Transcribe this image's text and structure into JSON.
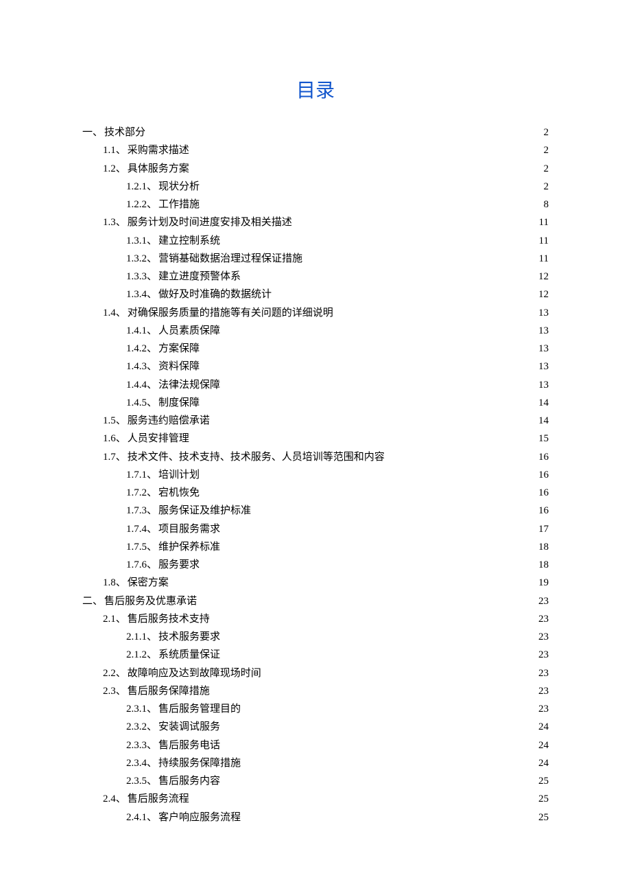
{
  "title": "目录",
  "toc": [
    {
      "level": 1,
      "num": "一、",
      "text": "技术部分",
      "page": "2"
    },
    {
      "level": 2,
      "num": "1.1、",
      "text": "采购需求描述",
      "page": "2"
    },
    {
      "level": 2,
      "num": "1.2、",
      "text": "具体服务方案",
      "page": "2"
    },
    {
      "level": 3,
      "num": "1.2.1、",
      "text": "现状分析",
      "page": "2"
    },
    {
      "level": 3,
      "num": "1.2.2、",
      "text": "工作措施",
      "page": "8"
    },
    {
      "level": 2,
      "num": "1.3、",
      "text": "服务计划及时间进度安排及相关描述",
      "page": "11"
    },
    {
      "level": 3,
      "num": "1.3.1、",
      "text": "建立控制系统",
      "page": "11"
    },
    {
      "level": 3,
      "num": "1.3.2、",
      "text": "营销基础数据治理过程保证措施",
      "page": "11"
    },
    {
      "level": 3,
      "num": "1.3.3、",
      "text": "建立进度预警体系",
      "page": "12"
    },
    {
      "level": 3,
      "num": "1.3.4、",
      "text": "做好及时准确的数据统计",
      "page": "12"
    },
    {
      "level": 2,
      "num": "1.4、",
      "text": "对确保服务质量的措施等有关问题的详细说明",
      "page": "13"
    },
    {
      "level": 3,
      "num": "1.4.1、",
      "text": "人员素质保障",
      "page": "13"
    },
    {
      "level": 3,
      "num": "1.4.2、",
      "text": "方案保障",
      "page": "13"
    },
    {
      "level": 3,
      "num": "1.4.3、",
      "text": "资料保障",
      "page": "13"
    },
    {
      "level": 3,
      "num": "1.4.4、",
      "text": "法律法规保障",
      "page": "13"
    },
    {
      "level": 3,
      "num": "1.4.5、",
      "text": "制度保障",
      "page": "14"
    },
    {
      "level": 2,
      "num": "1.5、",
      "text": "服务违约赔偿承诺",
      "page": "14"
    },
    {
      "level": 2,
      "num": "1.6、",
      "text": "人员安排管理",
      "page": "15"
    },
    {
      "level": 2,
      "num": "1.7、",
      "text": "技术文件、技术支持、技术服务、人员培训等范围和内容",
      "page": "16"
    },
    {
      "level": 3,
      "num": "1.7.1、",
      "text": "培训计划",
      "page": "16"
    },
    {
      "level": 3,
      "num": "1.7.2、",
      "text": "宕机恢免",
      "page": "16"
    },
    {
      "level": 3,
      "num": "1.7.3、",
      "text": "服务保证及维护标准",
      "page": "16"
    },
    {
      "level": 3,
      "num": "1.7.4、",
      "text": "项目服务需求",
      "page": "17"
    },
    {
      "level": 3,
      "num": "1.7.5、",
      "text": "维护保养标准",
      "page": "18"
    },
    {
      "level": 3,
      "num": "1.7.6、",
      "text": "服务要求",
      "page": "18"
    },
    {
      "level": 2,
      "num": "1.8、",
      "text": "保密方案",
      "page": "19"
    },
    {
      "level": 1,
      "num": "二、",
      "text": "售后服务及优惠承诺",
      "page": "23"
    },
    {
      "level": 2,
      "num": "2.1、",
      "text": "售后服务技术支持",
      "page": "23"
    },
    {
      "level": 3,
      "num": "2.1.1、",
      "text": "技术服务要求",
      "page": "23"
    },
    {
      "level": 3,
      "num": "2.1.2、",
      "text": "系统质量保证",
      "page": "23"
    },
    {
      "level": 2,
      "num": "2.2、",
      "text": "故障响应及达到故障现场时间",
      "page": "23"
    },
    {
      "level": 2,
      "num": "2.3、",
      "text": "售后服务保障措施",
      "page": "23"
    },
    {
      "level": 3,
      "num": "2.3.1、",
      "text": "售后服务管理目的",
      "page": "23"
    },
    {
      "level": 3,
      "num": "2.3.2、",
      "text": "安装调试服务",
      "page": "24"
    },
    {
      "level": 3,
      "num": "2.3.3、",
      "text": "售后服务电话",
      "page": "24"
    },
    {
      "level": 3,
      "num": "2.3.4、",
      "text": "持续服务保障措施",
      "page": "24"
    },
    {
      "level": 3,
      "num": "2.3.5、",
      "text": "售后服务内容",
      "page": "25"
    },
    {
      "level": 2,
      "num": "2.4、",
      "text": "售后服务流程",
      "page": "25"
    },
    {
      "level": 3,
      "num": "2.4.1、",
      "text": "客户响应服务流程",
      "page": "25"
    }
  ]
}
